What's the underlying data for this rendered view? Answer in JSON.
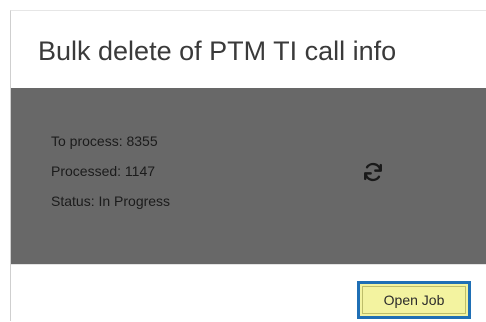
{
  "dialog": {
    "title": "Bulk delete of PTM TI call info"
  },
  "progress": {
    "to_process_text": "To process: 8355",
    "processed_text": "Processed: 1147",
    "status_text": "Status: In Progress",
    "to_process": 8355,
    "processed": 1147,
    "status": "In Progress",
    "spinner_icon": "refresh-icon"
  },
  "footer": {
    "open_job_label": "Open Job"
  },
  "colors": {
    "body_background": "#686868",
    "button_background": "#f3f3a0",
    "focus_outline": "#1f6fb5"
  }
}
